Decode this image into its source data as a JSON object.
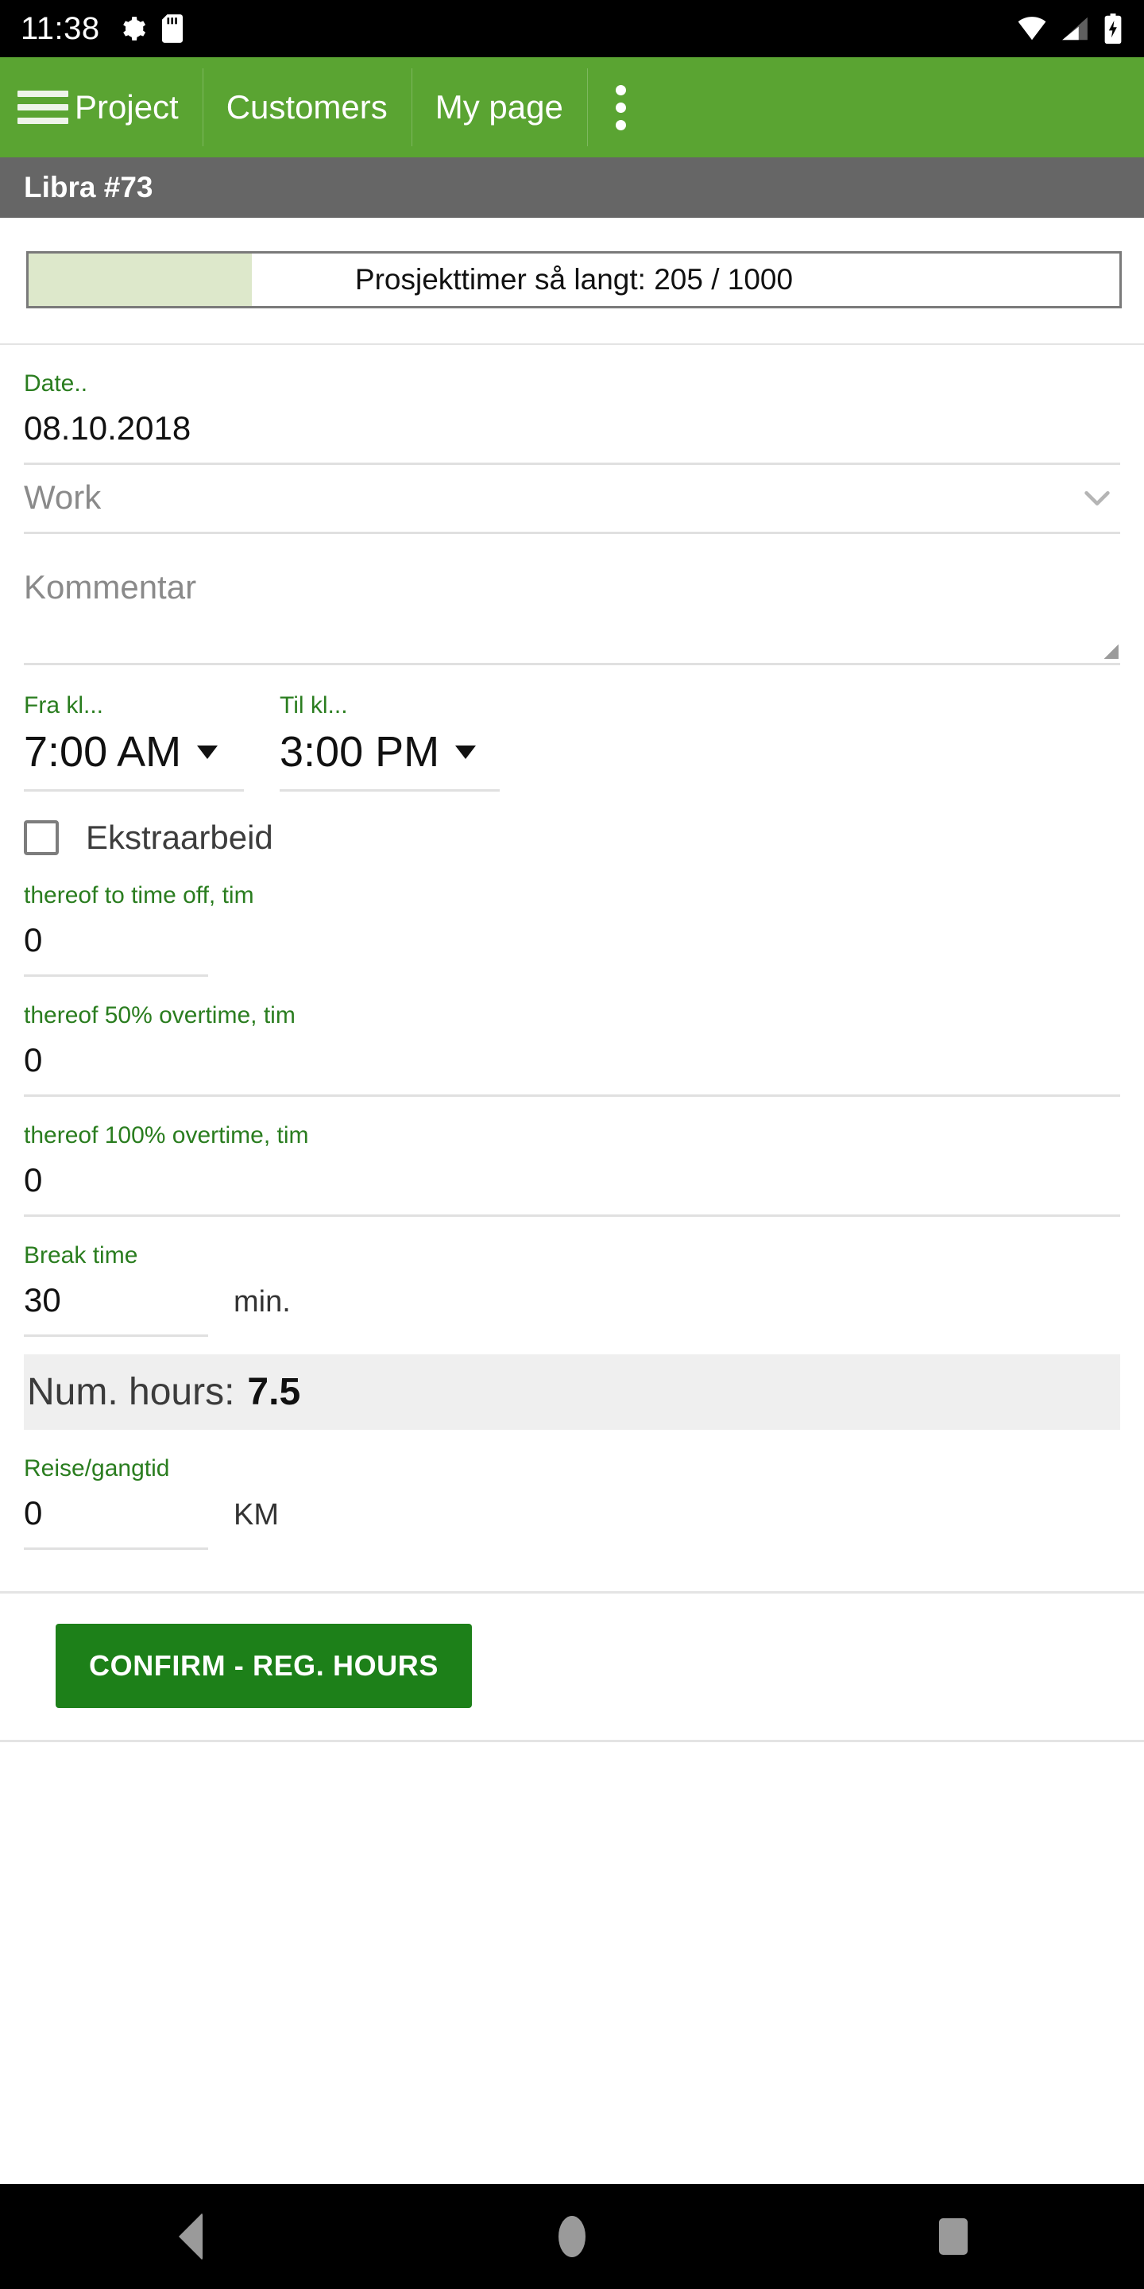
{
  "status_bar": {
    "time": "11:38",
    "left_icons": [
      "gear-icon",
      "sd-card-icon"
    ],
    "right_icons": [
      "wifi-icon",
      "cell-signal-icon",
      "battery-charging-icon"
    ]
  },
  "app_bar": {
    "menu_icon": "hamburger-menu-icon",
    "tabs": [
      {
        "label": "Project"
      },
      {
        "label": "Customers"
      },
      {
        "label": "My page"
      }
    ],
    "overflow_icon": "kebab-menu-icon",
    "background_color": "#5aa432"
  },
  "sub_bar": {
    "title": "Libra #73",
    "background_color": "#666666"
  },
  "progress": {
    "label": "Prosjekttimer så langt: 205 / 1000",
    "current": 205,
    "total": 1000,
    "percent": 20.5,
    "fill_color": "#dde8cb",
    "border_color": "#7a7a7a"
  },
  "form": {
    "date": {
      "label": "Date..",
      "value": "08.10.2018"
    },
    "work": {
      "placeholder": "Work",
      "value": "",
      "icon": "chevron-down-icon"
    },
    "comment": {
      "placeholder": "Kommentar",
      "value": ""
    },
    "from_time": {
      "label": "Fra kl...",
      "value": "7:00 AM",
      "icon": "triangle-down-icon"
    },
    "to_time": {
      "label": "Til kl...",
      "value": "3:00 PM",
      "icon": "triangle-down-icon"
    },
    "extra_work": {
      "label": "Ekstraarbeid",
      "checked": false
    },
    "time_off": {
      "label": "thereof to time off, tim",
      "value": "0"
    },
    "overtime_50": {
      "label": "thereof 50% overtime, tim",
      "value": "0"
    },
    "overtime_100": {
      "label": "thereof 100% overtime, tim",
      "value": "0"
    },
    "break_time": {
      "label": "Break time",
      "value": "30",
      "suffix": "min."
    },
    "num_hours": {
      "label": "Num. hours:",
      "value": "7.5"
    },
    "travel": {
      "label": "Reise/gangtid",
      "value": "0",
      "suffix": "KM"
    }
  },
  "footer": {
    "confirm_label": "CONFIRM - REG. HOURS",
    "confirm_color": "#1d8019"
  },
  "nav_bar": {
    "back": "back-triangle-icon",
    "home": "home-circle-icon",
    "recents": "recents-square-icon"
  },
  "colors": {
    "accent_green": "#5aa432",
    "label_green": "#2a7d1f",
    "button_green": "#1d8019",
    "sub_bar_gray": "#666666"
  }
}
